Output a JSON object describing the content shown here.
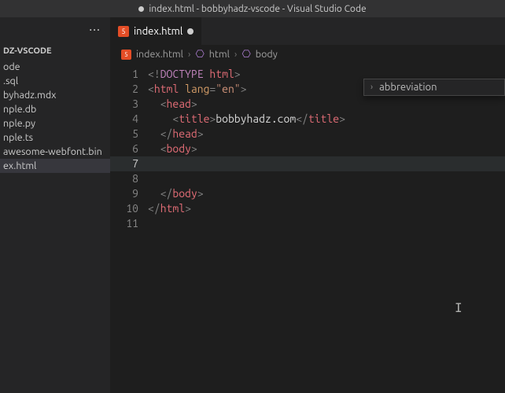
{
  "titlebar": {
    "text": "index.html - bobbyhadz-vscode - Visual Studio Code",
    "dirty": true
  },
  "sidebar": {
    "section": "DZ-VSCODE",
    "files": [
      {
        "name": "ode"
      },
      {
        "name": ".sql"
      },
      {
        "name": "byhadz.mdx"
      },
      {
        "name": "nple.db"
      },
      {
        "name": "nple.py"
      },
      {
        "name": "nple.ts"
      },
      {
        "name": "awesome-webfont.bin"
      },
      {
        "name": "ex.html",
        "active": true
      }
    ]
  },
  "tab": {
    "label": "index.html"
  },
  "breadcrumb": {
    "file": "index.html",
    "path1": "html",
    "path2": "body"
  },
  "suggest": {
    "label": "abbreviation"
  },
  "code": {
    "lines": [
      {
        "n": 1
      },
      {
        "n": 2
      },
      {
        "n": 3
      },
      {
        "n": 4
      },
      {
        "n": 5
      },
      {
        "n": 6
      },
      {
        "n": 7,
        "active": true
      },
      {
        "n": 8
      },
      {
        "n": 9
      },
      {
        "n": 10
      },
      {
        "n": 11
      }
    ],
    "tokens": {
      "l1_open": "<!",
      "l1_doctype": "DOCTYPE ",
      "l1_html": "html",
      "l1_close": ">",
      "l2_open": "<",
      "l2_tag": "html ",
      "l2_attr": "lang",
      "l2_eq": "=",
      "l2_str": "\"en\"",
      "l2_close": ">",
      "l3_open": "<",
      "l3_tag": "head",
      "l3_close": ">",
      "l4_open": "<",
      "l4_tag": "title",
      "l4_close": ">",
      "l4_text": "bobbyhadz.com",
      "l4_copen": "</",
      "l4_ctag": "title",
      "l4_cclose": ">",
      "l5_open": "</",
      "l5_tag": "head",
      "l5_close": ">",
      "l6_open": "<",
      "l6_tag": "body",
      "l6_close": ">",
      "l9_open": "</",
      "l9_tag": "body",
      "l9_close": ">",
      "l10_open": "</",
      "l10_tag": "html",
      "l10_close": ">"
    }
  }
}
